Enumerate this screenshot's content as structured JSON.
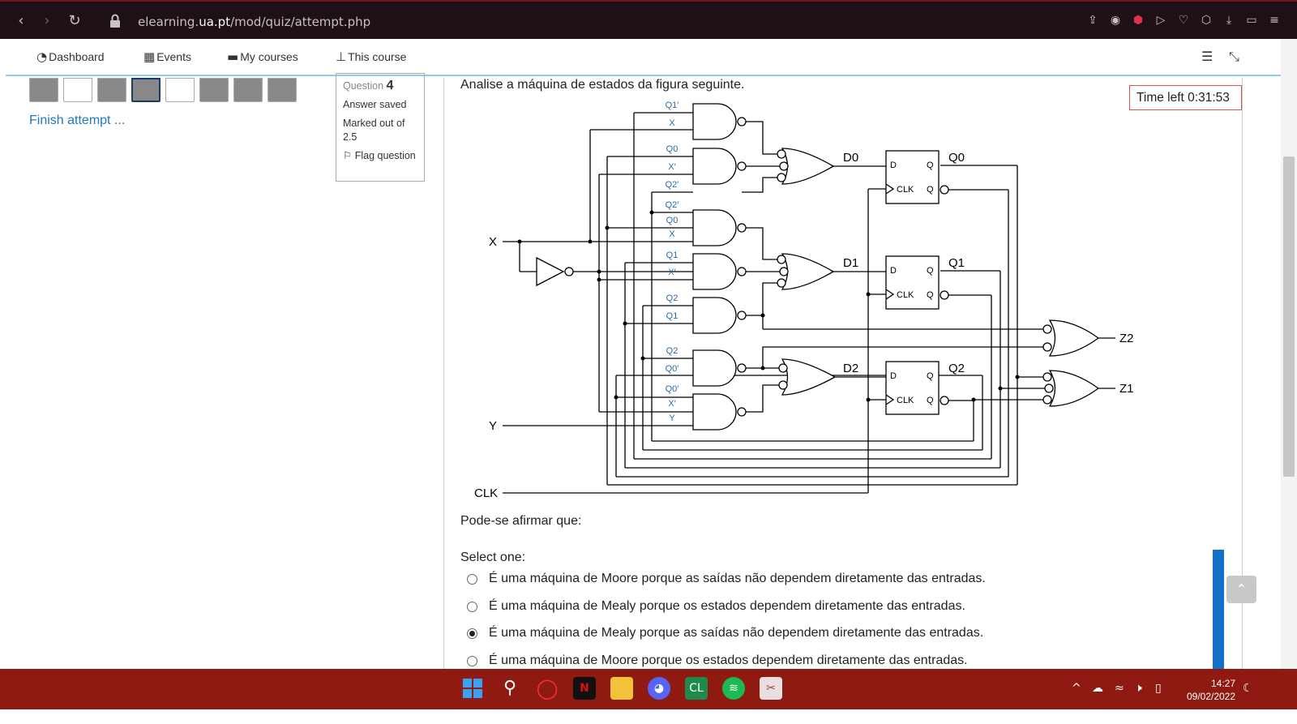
{
  "browser": {
    "url_prefix": "elearning.",
    "url_domain": "ua.pt",
    "url_path": "/mod/quiz/attempt.php"
  },
  "navbar": {
    "items": [
      {
        "label": "Dashboard",
        "icon": "dashboard-icon"
      },
      {
        "label": "Events",
        "icon": "calendar-icon"
      },
      {
        "label": "My courses",
        "icon": "briefcase-icon"
      },
      {
        "label": "This course",
        "icon": "sitemap-icon"
      }
    ]
  },
  "sidebar": {
    "finish_attempt": "Finish attempt ..."
  },
  "question_info": {
    "label": "Question",
    "number": "4",
    "status": "Answer saved",
    "marked": "Marked out of 2.5",
    "flag": "Flag question"
  },
  "timer": {
    "text": "Time left 0:31:53"
  },
  "question": {
    "intro": "Analise a máquina de estados da figura seguinte.",
    "prompt": "Pode-se afirmar que:",
    "select_label": "Select one:",
    "options": [
      {
        "text": "É uma máquina de Moore porque as saídas não dependem diretamente das entradas.",
        "checked": false
      },
      {
        "text": "É uma máquina de Mealy porque os estados dependem diretamente das entradas.",
        "checked": false
      },
      {
        "text": "É uma máquina de Mealy porque as saídas não dependem diretamente das entradas.",
        "checked": true
      },
      {
        "text": "É uma máquina de Moore porque os estados dependem diretamente das entradas.",
        "checked": false
      }
    ]
  },
  "circuit": {
    "inputs": [
      "X",
      "Y",
      "CLK"
    ],
    "and_labels": [
      [
        "Q1′",
        "X"
      ],
      [
        "Q0",
        "X′",
        "Q2′"
      ],
      [
        "Q2′",
        "Q0",
        "X"
      ],
      [
        "Q1",
        "X′"
      ],
      [
        "Q2",
        "Q1"
      ],
      [
        "Q2",
        "Q0′"
      ],
      [
        "Q0′",
        "X′",
        "Y"
      ]
    ],
    "d_labels": [
      "D0",
      "D1",
      "D2"
    ],
    "q_labels": [
      "Q0",
      "Q1",
      "Q2"
    ],
    "ff_d": "D",
    "ff_q": "Q",
    "ff_clk": "CLK",
    "outputs": [
      "Z2",
      "Z1"
    ]
  },
  "taskbar": {
    "time": "14:27",
    "date": "09/02/2022"
  }
}
